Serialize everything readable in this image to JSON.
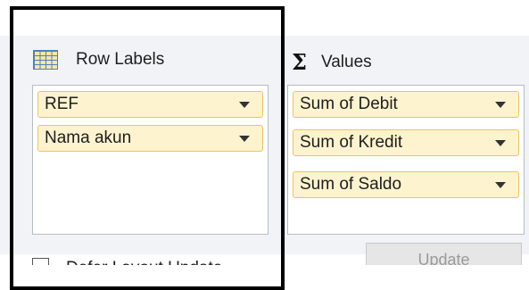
{
  "row_labels": {
    "header": "Row Labels",
    "icon": "table-grid-icon",
    "fields": [
      "REF",
      "Nama akun"
    ]
  },
  "values": {
    "header": "Values",
    "icon": "sigma-icon",
    "fields": [
      "Sum of Debit",
      "Sum of Kredit",
      "Sum of Saldo"
    ]
  },
  "footer": {
    "defer_checkbox_label": "Defer Layout Update",
    "update_button": "Update"
  },
  "colors": {
    "chip_fill": "#fdf3cf",
    "chip_border": "#f0c35b",
    "panel_bg": "#f1f3f6"
  }
}
